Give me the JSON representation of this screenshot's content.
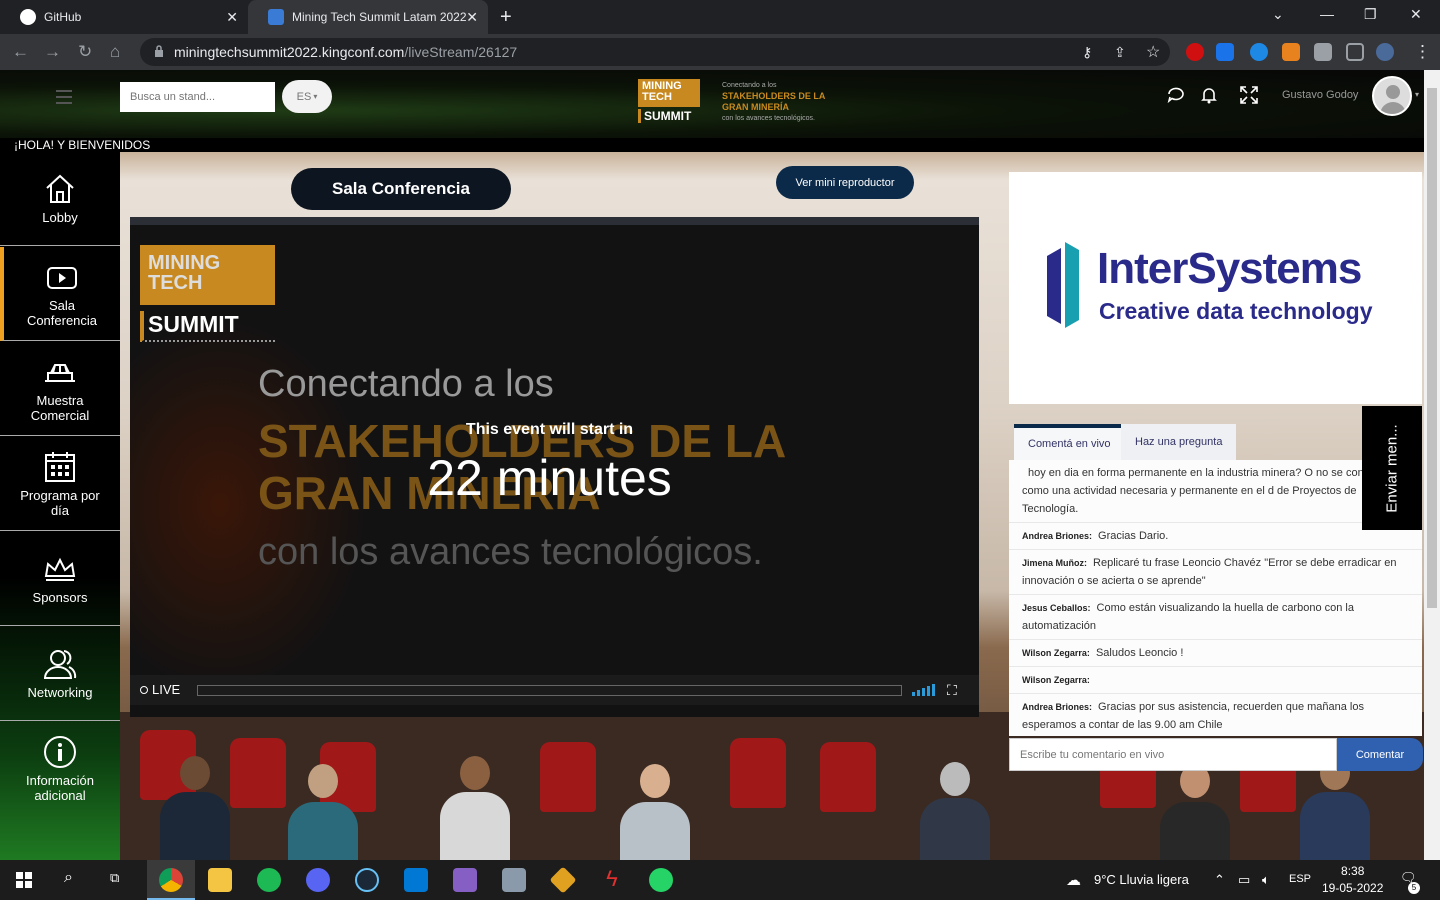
{
  "browser": {
    "tabs": [
      {
        "title": "GitHub"
      },
      {
        "title": "Mining Tech Summit Latam 2022"
      }
    ],
    "url_host": "miningtechsummit2022.kingconf.com",
    "url_path": "/liveStream/26127"
  },
  "header": {
    "search_placeholder": "Busca un stand...",
    "language": "ES",
    "logo_top": "MINING TECH",
    "logo_bottom": "SUMMIT",
    "slogan_small": "Conectando a los",
    "slogan_big": "STAKEHOLDERS DE LA GRAN MINERÍA",
    "slogan_end": "con los avances tecnológicos.",
    "username": "Gustavo Godoy"
  },
  "welcome": "¡HOLA!  Y BIENVENIDOS",
  "sidebar": {
    "items": [
      {
        "label": "Lobby",
        "icon": "home-icon"
      },
      {
        "label": "Sala Conferencia",
        "icon": "play-icon"
      },
      {
        "label": "Muestra Comercial",
        "icon": "stand-icon"
      },
      {
        "label": "Programa por día",
        "icon": "calendar-icon"
      },
      {
        "label": "Sponsors",
        "icon": "crown-icon"
      },
      {
        "label": "Networking",
        "icon": "users-icon"
      },
      {
        "label": "Información adicional",
        "icon": "info-icon"
      }
    ]
  },
  "stage": {
    "title": "Sala Conferencia",
    "mini_player": "Ver mini reproductor"
  },
  "player": {
    "logo_top": "MINING TECH",
    "logo_bottom": "SUMMIT",
    "line1": "Conectando a los",
    "line2": "STAKEHOLDERS DE LA GRAN MINERÍA",
    "line3": "con los avances tecnológicos.",
    "start_text": "This event will start in",
    "countdown": "22 minutes",
    "live_label": "LIVE"
  },
  "sponsor": {
    "name": "InterSystems",
    "tagline": "Creative data technology"
  },
  "chat": {
    "tabs": [
      "Comentá en vivo",
      "Haz una pregunta"
    ],
    "send_side_label": "Enviar men...",
    "messages": [
      {
        "author": "",
        "text": "hoy en dia en forma permanente en la industria minera? O no se considerado como una actividad necesaria y permanente en el d de Proyectos de Tecnología."
      },
      {
        "author": "Andrea Briones:",
        "text": "Gracias Dario."
      },
      {
        "author": "Jimena Muñoz:",
        "text": "Replicaré tu frase Leoncio Chavéz \"Error se debe erradicar en innovación o se acierta o se aprende\""
      },
      {
        "author": "Jesus Ceballos:",
        "text": "Como están visualizando la huella de carbono con la automatización"
      },
      {
        "author": "Wilson Zegarra:",
        "text": "Saludos Leoncio !"
      },
      {
        "author": "Wilson Zegarra:",
        "text": ""
      },
      {
        "author": "Andrea Briones:",
        "text": "Gracias por sus asistencia, recuerden que mañana los esperamos a contar de las 9.00 am Chile"
      }
    ],
    "input_placeholder": "Escribe tu comentario en vivo",
    "submit": "Comentar"
  },
  "taskbar": {
    "weather": "9°C  Lluvia ligera",
    "lang": "ESP",
    "time": "8:38",
    "date": "19-05-2022",
    "notifications": "5"
  }
}
